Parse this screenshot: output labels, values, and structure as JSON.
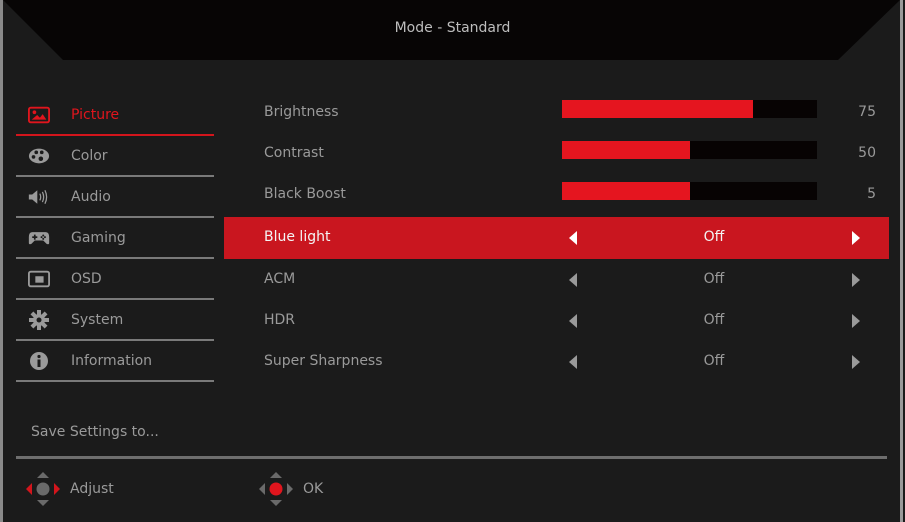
{
  "header": {
    "title": "Mode - Standard"
  },
  "sidebar": {
    "items": [
      {
        "label": "Picture",
        "icon": "picture-icon",
        "active": true
      },
      {
        "label": "Color",
        "icon": "palette-icon",
        "active": false
      },
      {
        "label": "Audio",
        "icon": "speaker-icon",
        "active": false
      },
      {
        "label": "Gaming",
        "icon": "gamepad-icon",
        "active": false
      },
      {
        "label": "OSD",
        "icon": "osd-window-icon",
        "active": false
      },
      {
        "label": "System",
        "icon": "gear-icon",
        "active": false
      },
      {
        "label": "Information",
        "icon": "info-icon",
        "active": false
      }
    ],
    "save_settings": "Save Settings to..."
  },
  "settings": {
    "sliders": [
      {
        "label": "Brightness",
        "value": "75",
        "fill_percent": 75
      },
      {
        "label": "Contrast",
        "value": "50",
        "fill_percent": 50
      },
      {
        "label": "Black Boost",
        "value": "5",
        "fill_percent": 50
      }
    ],
    "options": [
      {
        "label": "Blue light",
        "value": "Off",
        "selected": true
      },
      {
        "label": "ACM",
        "value": "Off",
        "selected": false
      },
      {
        "label": "HDR",
        "value": "Off",
        "selected": false
      },
      {
        "label": "Super Sharpness",
        "value": "Off",
        "selected": false
      }
    ]
  },
  "footer": {
    "adjust_label": "Adjust",
    "ok_label": "OK"
  },
  "colors": {
    "accent": "#e0151d",
    "highlight_row": "#c9161f",
    "slider_fill": "#e5151f",
    "text": "#9a9a9a",
    "background": "#1b1b1b"
  }
}
